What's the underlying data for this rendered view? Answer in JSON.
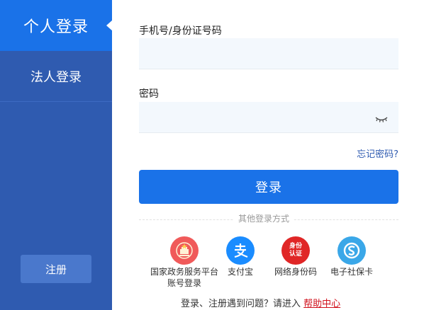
{
  "sidebar": {
    "personal_login": "个人登录",
    "legal_login": "法人登录",
    "register": "注册"
  },
  "form": {
    "phone_label": "手机号/身份证号码",
    "phone_value": "",
    "password_label": "密码",
    "password_value": "",
    "forgot_password": "忘记密码?",
    "login_button": "登录"
  },
  "other_login": {
    "title": "其他登录方式",
    "methods": [
      {
        "label": "国家政务服务平台账号登录",
        "icon": "national-emblem-icon",
        "color": "#f05a5a"
      },
      {
        "label": "支付宝",
        "icon": "alipay-icon",
        "color": "#1a8cff"
      },
      {
        "label": "网络身份码",
        "icon": "network-id-icon",
        "color": "#e02626",
        "icon_text_1": "身份",
        "icon_text_2": "认证"
      },
      {
        "label": "电子社保卡",
        "icon": "social-security-card-icon",
        "color": "#3aa7e8"
      }
    ]
  },
  "help": {
    "text": "登录、注册遇到问题？请进入",
    "link": "帮助中心"
  },
  "colors": {
    "sidebar_bg": "#2f5bb0",
    "active_tab": "#1a72e8",
    "primary": "#1a72e8",
    "link": "#2f5bb0",
    "help_link": "#d0101b"
  }
}
